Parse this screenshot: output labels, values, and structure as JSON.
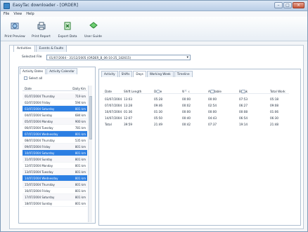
{
  "window": {
    "title": "EasyTac downloader - [ORDER]",
    "controls": [
      "–",
      "□",
      "×"
    ]
  },
  "menu": [
    "File",
    "View",
    "Help"
  ],
  "toolbar": [
    {
      "label": "Print Preview",
      "icon": "print-preview-icon"
    },
    {
      "label": "Print Report",
      "icon": "print-report-icon"
    },
    {
      "label": "Export Data",
      "icon": "export-data-icon"
    },
    {
      "label": "User Guide",
      "icon": "user-guide-icon"
    }
  ],
  "main_tabs": [
    "Activities",
    "Events & Faults"
  ],
  "selected_file": {
    "label": "Selected File",
    "value": "01/07/2004 - 31/12/2005 (ORDER_B_06-10-25_182615)"
  },
  "left_tabs": [
    "Activity Dates",
    "Activity Calendar"
  ],
  "select_all_label": "Select all",
  "activity_list": {
    "headers": [
      "Date",
      "Daily Km"
    ],
    "rows": [
      {
        "date": "01/07/2004 Thursday",
        "km": "719 km",
        "selected": false
      },
      {
        "date": "02/07/2004 Friday",
        "km": "594 km",
        "selected": false
      },
      {
        "date": "03/07/2004 Saturday",
        "km": "801 km",
        "selected": true
      },
      {
        "date": "04/07/2004 Sunday",
        "km": "684 km",
        "selected": false
      },
      {
        "date": "05/07/2004 Monday",
        "km": "900 km",
        "selected": false
      },
      {
        "date": "06/07/2004 Tuesday",
        "km": "781 km",
        "selected": false
      },
      {
        "date": "07/07/2004 Wednesday",
        "km": "801 km",
        "selected": true
      },
      {
        "date": "08/07/2004 Thursday",
        "km": "535 km",
        "selected": false
      },
      {
        "date": "09/07/2004 Friday",
        "km": "801 km",
        "selected": false
      },
      {
        "date": "10/07/2004 Saturday",
        "km": "801 km",
        "selected": true
      },
      {
        "date": "11/07/2004 Sunday",
        "km": "801 km",
        "selected": false
      },
      {
        "date": "12/07/2004 Monday",
        "km": "801 km",
        "selected": false
      },
      {
        "date": "13/07/2004 Tuesday",
        "km": "801 km",
        "selected": false
      },
      {
        "date": "14/07/2004 Wednesday",
        "km": "801 km",
        "selected": true
      },
      {
        "date": "15/07/2004 Thursday",
        "km": "801 km",
        "selected": false
      },
      {
        "date": "16/07/2004 Friday",
        "km": "801 km",
        "selected": false
      },
      {
        "date": "17/07/2004 Saturday",
        "km": "801 km",
        "selected": false
      },
      {
        "date": "18/07/2004 Sunday",
        "km": "801 km",
        "selected": false
      }
    ]
  },
  "right_tabs": [
    "Activity",
    "Shifts",
    "Days",
    "Working Week",
    "Timeline"
  ],
  "days_table": {
    "headers": [
      "Date",
      "Shift Length",
      "Drive",
      "Work",
      "Available",
      "Break",
      "Total Work"
    ],
    "rows": [
      {
        "date": "03/07/2004",
        "shift": "13:03",
        "drive": "05:28",
        "work": "00:00",
        "available": "00:00",
        "break": "07:53",
        "total": "05:18"
      },
      {
        "date": "07/07/2004",
        "shift": "13:28",
        "drive": "09:46",
        "work": "00:02",
        "available": "02:54",
        "break": "06:27",
        "total": "09:08"
      },
      {
        "date": "10/07/2004",
        "shift": "01:36",
        "drive": "01:30",
        "work": "00:00",
        "available": "00:00",
        "break": "00:08",
        "total": "01:06"
      },
      {
        "date": "14/07/2004",
        "shift": "12:07",
        "drive": "05:50",
        "work": "00:40",
        "available": "04:43",
        "break": "06:54",
        "total": "06:30"
      },
      {
        "date": "Total",
        "shift": "39:59",
        "drive": "21:49",
        "work": "00:42",
        "available": "07:37",
        "break": "19:14",
        "total": "21:48"
      }
    ]
  }
}
